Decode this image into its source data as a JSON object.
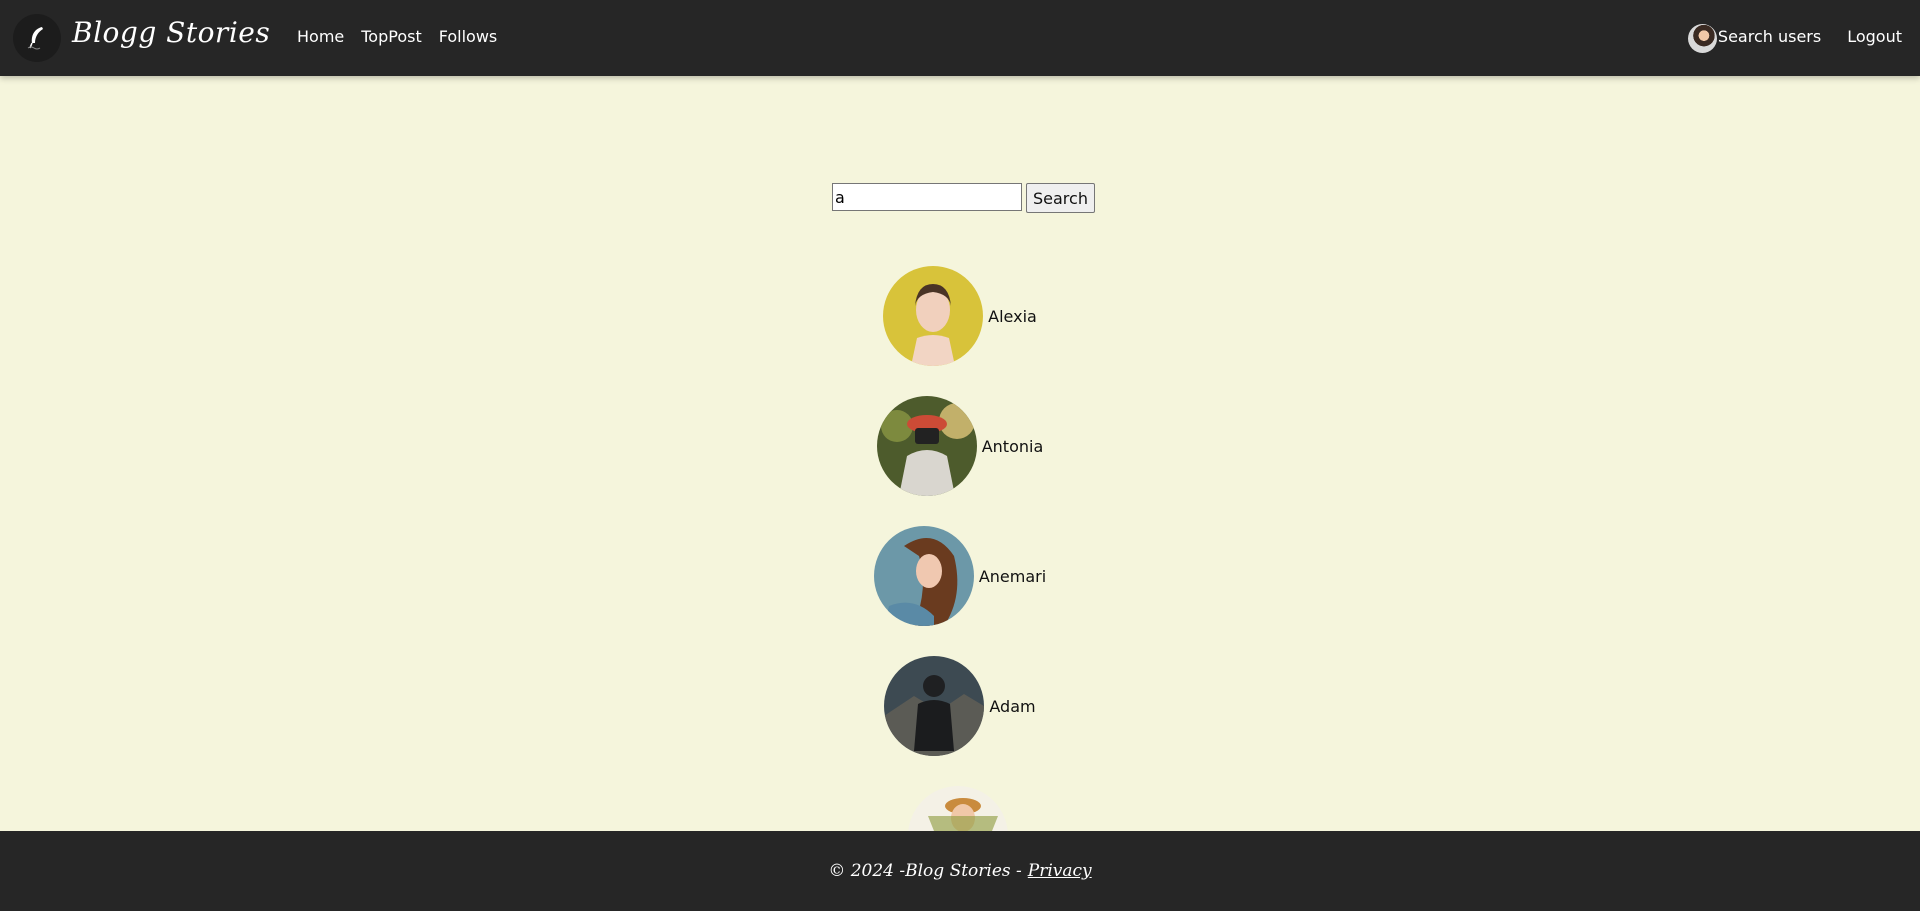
{
  "header": {
    "brand": "Blogg Stories",
    "nav": [
      "Home",
      "TopPost",
      "Follows"
    ],
    "right": {
      "search_users": "Search users",
      "logout": "Logout"
    }
  },
  "search": {
    "value": "a",
    "button": "Search"
  },
  "users": [
    {
      "name": "Alexia"
    },
    {
      "name": "Antonia"
    },
    {
      "name": "Anemari"
    },
    {
      "name": "Adam"
    },
    {
      "name": ""
    }
  ],
  "footer": {
    "text": "© 2024 -Blog Stories -",
    "privacy": "Privacy"
  },
  "colors": {
    "header_bg": "#262626",
    "page_bg": "#f5f5dc",
    "footer_bg": "#262626"
  }
}
